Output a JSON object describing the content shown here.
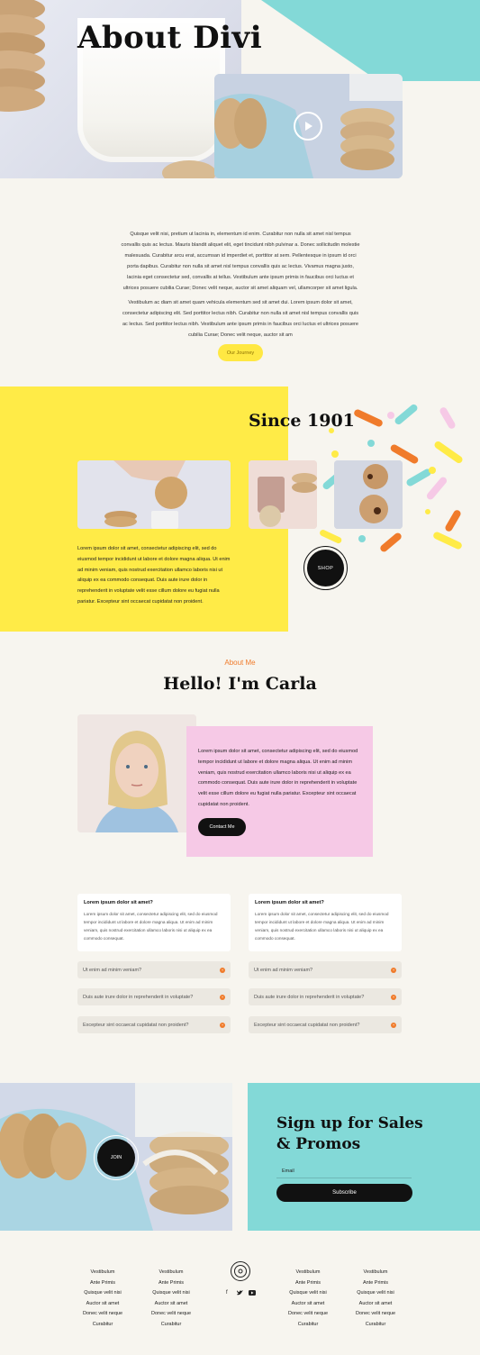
{
  "hero": {
    "title": "About Divi",
    "video_label": "play-icon"
  },
  "intro": {
    "paragraph1": "Quisque velit nisi, pretium ut lacinia in, elementum id enim. Curabitur non nulla sit amet nisl tempus convallis quis ac lectus. Mauris blandit aliquet elit, eget tincidunt nibh pulvinar a. Donec sollicitudin molestie malesuada. Curabitur arcu erat, accumsan id imperdiet et, porttitor at sem. Pellentesque in ipsum id orci porta dapibus. Curabitur non nulla sit amet nisl tempus convallis quis ac lectus. Vivamus magna justo, lacinia eget consectetur sed, convallis at tellus. Vestibulum ante ipsum primis in faucibus orci luctus et ultrices posuere cubilia Curae; Donec velit neque, auctor sit amet aliquam vel, ullamcorper sit amet ligula.",
    "paragraph2": "Vestibulum ac diam sit amet quam vehicula elementum sed sit amet dui. Lorem ipsum dolor sit amet, consectetur adipiscing elit. Sed porttitor lectus nibh. Curabitur non nulla sit amet nisl tempus convallis quis ac lectus. Sed porttitor lectus nibh. Vestibulum ante ipsum primis in faucibus orci luctus et ultrices posuere cubilia Curae; Donec velit neque, auctor sit am",
    "button": "Our Journey"
  },
  "since": {
    "title": "Since 1901",
    "text": "Lorem ipsum dolor sit amet, consectetur adipiscing elit, sed do eiusmod tempor incididunt ut labore et dolore magna aliqua. Ut enim ad minim veniam, quis nostrud exercitation ullamco laboris nisi ut aliquip ex ea commodo consequat. Duis aute irure dolor in reprehenderit in voluptate velit esse cillum dolore eu fugiat nulla pariatur. Excepteur sint occaecat cupidatat non proident.",
    "shop_button": "SHOP"
  },
  "about": {
    "eyebrow": "About Me",
    "title": "Hello! I'm Carla",
    "text": "Lorem ipsum dolor sit amet, consectetur adipiscing elit, sed do eiusmod tempor incididunt ut labore et dolore magna aliqua. Ut enim ad minim veniam, quis nostrud exercitation ullamco laboris nisi ut aliquip ex ea commodo consequat. Duis aute irure dolor in reprehenderit in voluptate velit esse cillum dolore eu fugiat nulla pariatur. Excepteur sint occaecat cupidatat non proident.",
    "contact_button": "Contact Me"
  },
  "faq": {
    "left": {
      "open_title": "Lorem ipsum dolor sit amet?",
      "open_body": "Lorem ipsum dolor sit amet, consectetur adipiscing elit, sed do eiusmod tempor incididunt ut labore et dolore magna aliqua. Ut enim ad minim veniam, quis nostrud exercitation ullamco laboris nisi ut aliquip ex ea commodo consequat.",
      "items": [
        "Ut enim ad minim veniam?",
        "Duis aute irure dolor in reprehenderit in voluptate?",
        "Excepteur sint occaecat cupidatat non proident?"
      ]
    },
    "right": {
      "open_title": "Lorem ipsum dolor sit amet?",
      "open_body": "Lorem ipsum dolor sit amet, consectetur adipiscing elit, sed do eiusmod tempor incididunt ut labore et dolore magna aliqua. Ut enim ad minim veniam, quis nostrud exercitation ullamco laboris nisi ut aliquip ex ea commodo consequat.",
      "items": [
        "Ut enim ad minim veniam?",
        "Duis aute irure dolor in reprehenderit in voluptate?",
        "Excepteur sint occaecat cupidatat non proident?"
      ]
    }
  },
  "signup": {
    "join_button": "JOIN",
    "title_line1": "Sign up for Sales",
    "title_line2": "& Promos",
    "email_label": "Email",
    "subscribe_button": "Subscribe"
  },
  "footer": {
    "col1": [
      "Vestibulum",
      "Ante Primis",
      "Quisque velit nisi",
      "Auctor sit amet",
      "Donec velit neque",
      "Curabitur"
    ],
    "col2": [
      "Vestibulum",
      "Ante Primis",
      "Quisque velit nisi",
      "Auctor sit amet",
      "Donec velit neque",
      "Curabitur"
    ],
    "col3": [
      "Vestibulum",
      "Ante Primis",
      "Quisque velit nisi",
      "Auctor sit amet",
      "Donec velit neque",
      "Curabitur"
    ],
    "col4": [
      "Vestibulum",
      "Ante Primis",
      "Quisque velit nisi",
      "Auctor sit amet",
      "Donec velit neque",
      "Curabitur"
    ],
    "social": [
      "facebook-icon",
      "twitter-icon",
      "youtube-icon"
    ]
  },
  "colors": {
    "background": "#f7f5ef",
    "yellow": "#ffeb47",
    "teal": "#83d9d7",
    "pink": "#f6c9e6",
    "orange": "#f07b2b",
    "black": "#111111"
  }
}
